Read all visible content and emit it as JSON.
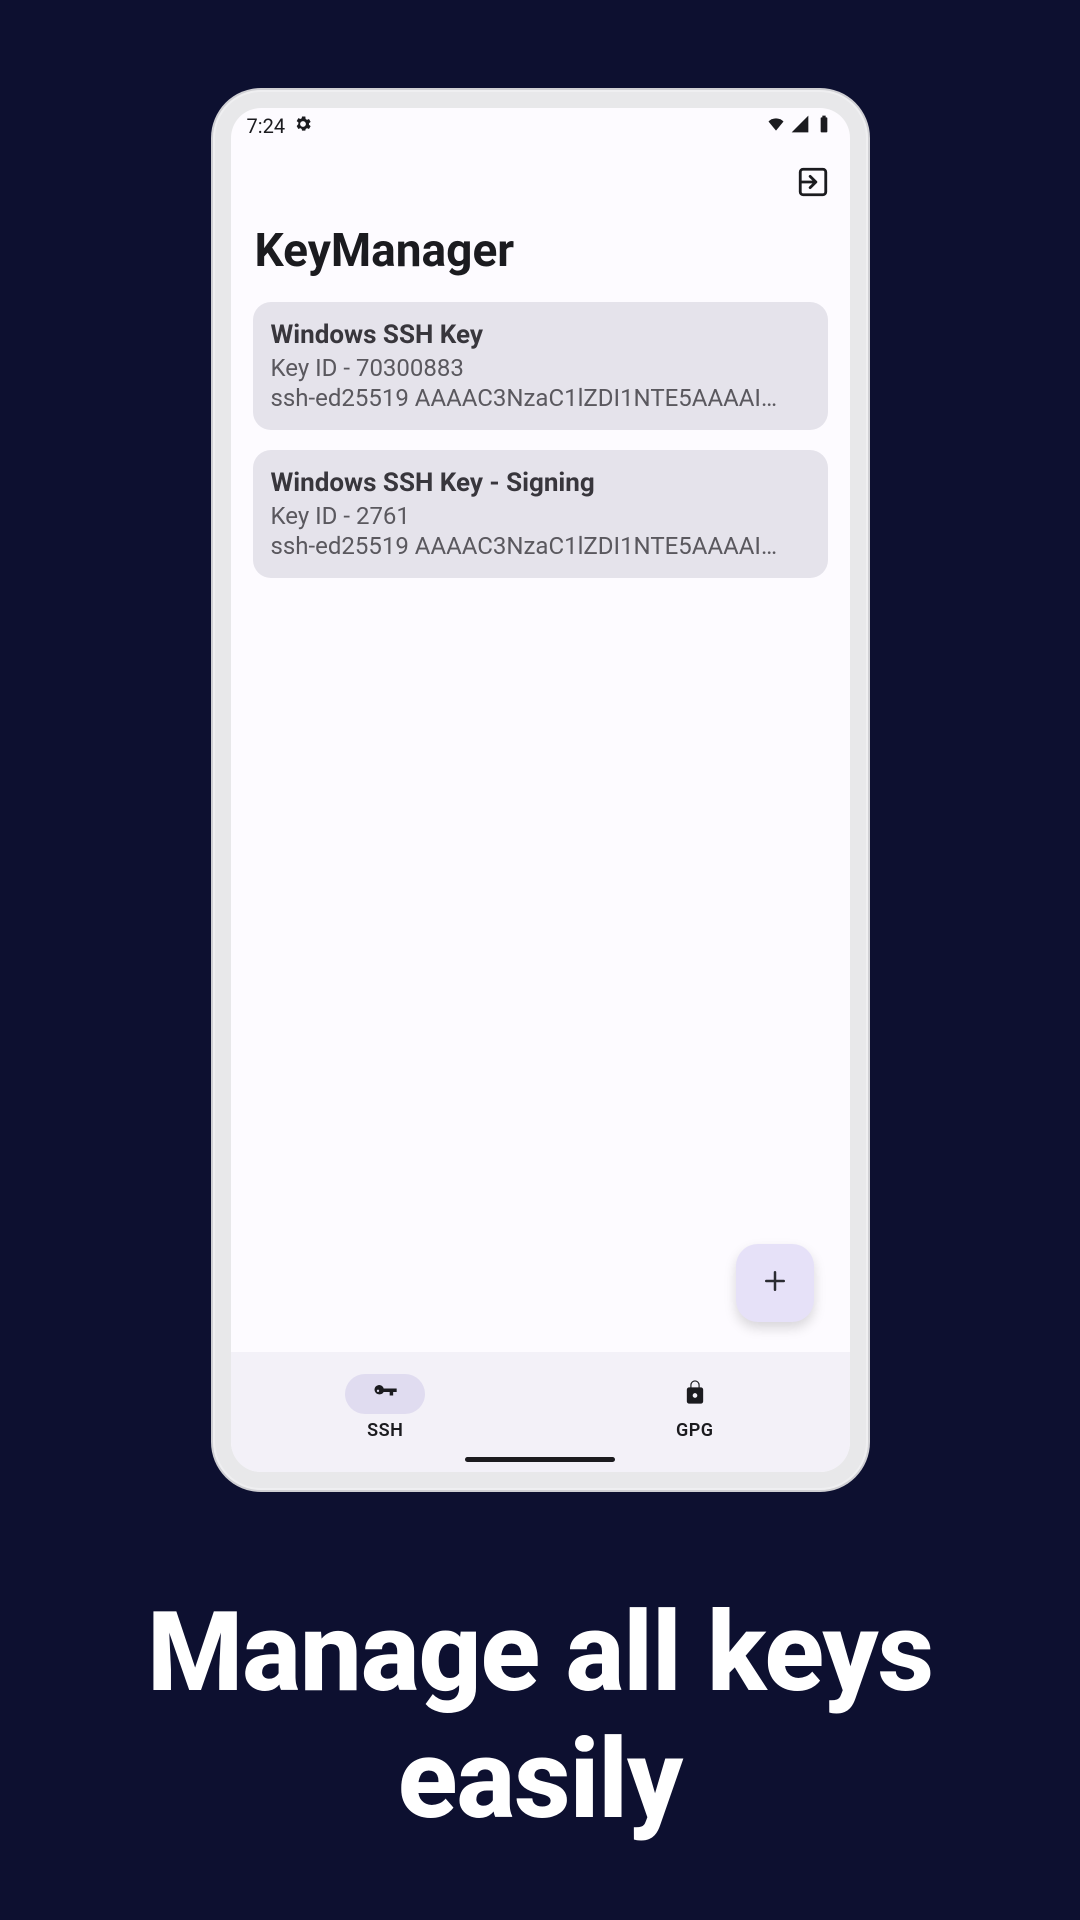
{
  "status": {
    "time": "7:24"
  },
  "app": {
    "title": "KeyManager"
  },
  "keys": [
    {
      "title": "Windows SSH Key",
      "id_line": "Key ID - 70300883",
      "fingerprint": "ssh-ed25519 AAAAC3NzaC1lZDI1NTE5AAAAI…"
    },
    {
      "title": "Windows SSH Key - Signing",
      "id_line": "Key ID - 2761",
      "fingerprint": "ssh-ed25519 AAAAC3NzaC1lZDI1NTE5AAAAI…"
    }
  ],
  "nav": {
    "ssh": "SSH",
    "gpg": "GPG"
  },
  "promo": {
    "line1": "Manage all keys",
    "line2": "easily"
  }
}
